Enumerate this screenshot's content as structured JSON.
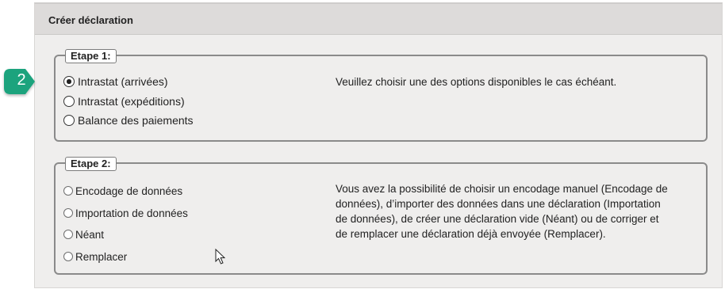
{
  "panel": {
    "title": "Créer déclaration"
  },
  "step1": {
    "legend": "Etape 1:",
    "options": [
      {
        "label": "Intrastat (arrivées)",
        "selected": true
      },
      {
        "label": "Intrastat (expéditions)",
        "selected": false
      },
      {
        "label": "Balance des paiements",
        "selected": false
      }
    ],
    "help": "Veuillez choisir une des options disponibles le cas échéant."
  },
  "step2": {
    "legend": "Etape 2:",
    "options": [
      {
        "label": "Encodage de données",
        "selected": false
      },
      {
        "label": "Importation de données",
        "selected": false
      },
      {
        "label": "Néant",
        "selected": false
      },
      {
        "label": "Remplacer",
        "selected": false
      }
    ],
    "help": "Vous avez la possibilité de choisir un encodage manuel (Encodage de\ndonnées), d’importer des données dans une déclaration (Importation\nde données), de créer une déclaration vide (Néant) ou de corriger et\nde remplacer une déclaration déjà envoyée (Remplacer)."
  },
  "annotation": {
    "step_badge": "2",
    "badge_color": "#1aa37d"
  },
  "icons": {
    "badge": "step-badge-icon",
    "cursor": "mouse-cursor-icon"
  }
}
